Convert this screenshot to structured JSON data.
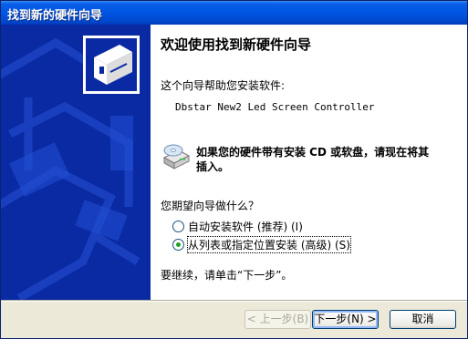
{
  "window": {
    "title": "找到新的硬件向导"
  },
  "wizard": {
    "heading": "欢迎使用找到新硬件向导",
    "intro": "这个向导帮助您安装软件:",
    "device_name": "Dbstar New2 Led Screen Controller",
    "cd_prompt": "如果您的硬件带有安装 CD 或软盘，请现在将其插入。",
    "question": "您期望向导做什么？",
    "options": [
      {
        "label": "自动安装软件 (推荐) (I)",
        "selected": false
      },
      {
        "label": "从列表或指定位置安装 (高级) (S)",
        "selected": true
      }
    ],
    "continue_text": "要继续，请单击“下一步”。"
  },
  "buttons": {
    "back": "< 上一步(B)",
    "next": "下一步(N) >",
    "cancel": "取消"
  },
  "colors": {
    "titlebar": "#0055e3",
    "sidebar": "#0a2aa4",
    "radio_dot": "#21a121"
  },
  "icons": [
    "hardware-card-icon",
    "cd-drive-icon"
  ]
}
